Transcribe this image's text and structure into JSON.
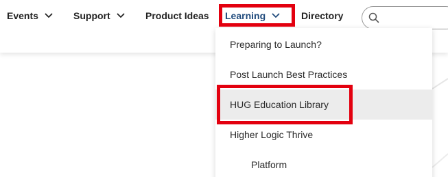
{
  "nav": {
    "items": [
      {
        "label": "Events",
        "has_caret": true
      },
      {
        "label": "Support",
        "has_caret": true
      },
      {
        "label": "Product Ideas",
        "has_caret": false
      },
      {
        "label": "Learning",
        "has_caret": true,
        "active": true
      },
      {
        "label": "Directory",
        "has_caret": false
      }
    ],
    "search": {
      "placeholder": "",
      "icon": "search-icon"
    }
  },
  "learning_menu": {
    "items": [
      {
        "label": "Preparing to Launch?"
      },
      {
        "label": "Post Launch Best Practices"
      },
      {
        "label": "HUG Education Library",
        "highlighted": true
      },
      {
        "label": "Higher Logic Thrive"
      },
      {
        "label": "Platform",
        "indent": true
      }
    ]
  },
  "colors": {
    "active_nav": "#1f4a7c",
    "annotation_red": "#e3000f",
    "hover_bg": "#ececec",
    "text": "#222222"
  }
}
